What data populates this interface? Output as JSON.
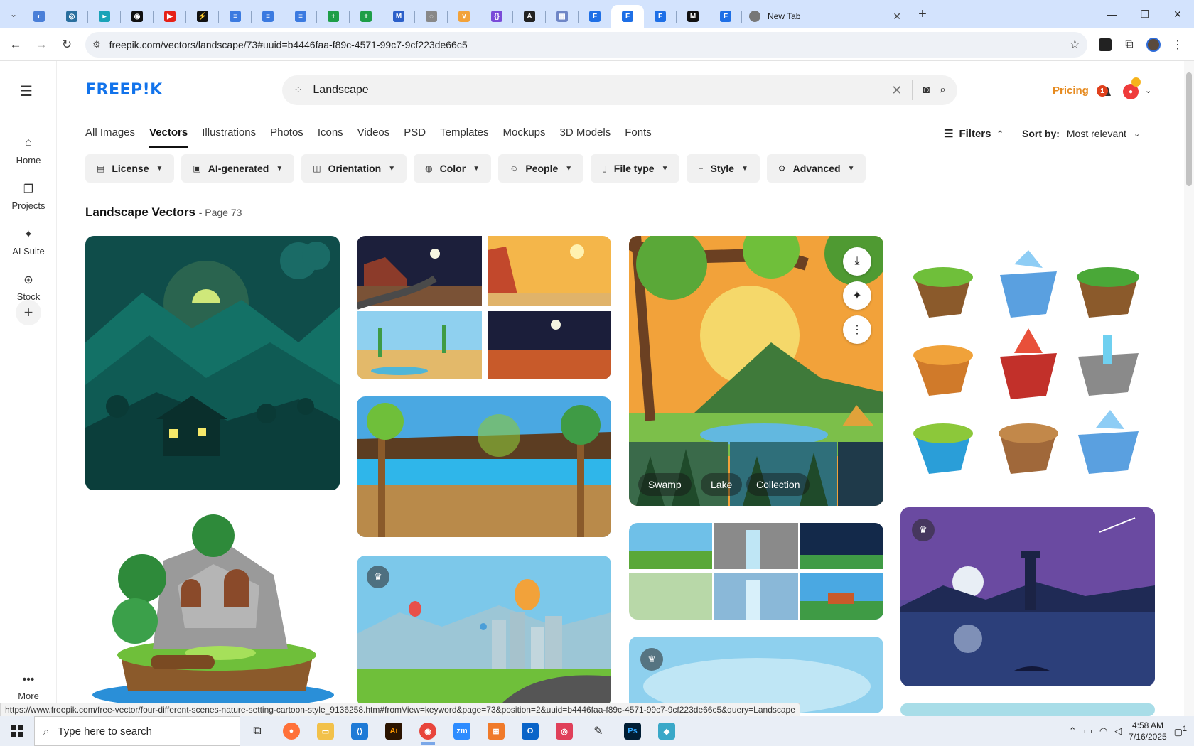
{
  "browser": {
    "newtab_title": "New Tab",
    "url": "freepik.com/vectors/landscape/73#uuid=b4446faa-f89c-4571-99c7-9cf223de66c5",
    "status_link": "https://www.freepik.com/free-vector/four-different-scenes-nature-setting-cartoon-style_9136258.htm#fromView=keyword&page=73&position=2&uuid=b4446faa-f89c-4571-99c7-9cf223de66c5&query=Landscape"
  },
  "rail": {
    "home": "Home",
    "projects": "Projects",
    "ai_suite": "AI Suite",
    "stock": "Stock",
    "more": "More"
  },
  "header": {
    "logo": "FREEP!K",
    "search_value": "Landscape",
    "pricing": "Pricing",
    "notif_count": "1"
  },
  "categories": [
    "All Images",
    "Vectors",
    "Illustrations",
    "Photos",
    "Icons",
    "Videos",
    "PSD",
    "Templates",
    "Mockups",
    "3D Models",
    "Fonts"
  ],
  "active_category": "Vectors",
  "sort": {
    "filters_label": "Filters",
    "label": "Sort by:",
    "value": "Most relevant"
  },
  "chips": [
    "License",
    "AI-generated",
    "Orientation",
    "Color",
    "People",
    "File type",
    "Style",
    "Advanced"
  ],
  "section": {
    "title": "Landscape Vectors",
    "page": "- Page 73"
  },
  "card_tags": [
    "Swamp",
    "Lake",
    "Collection"
  ],
  "taskbar": {
    "search_placeholder": "Type here to search",
    "time": "4:58 AM",
    "date": "7/16/2025",
    "notif": "1"
  },
  "colors": {
    "brand": "#1273eb",
    "pricing": "#e68a1e"
  }
}
